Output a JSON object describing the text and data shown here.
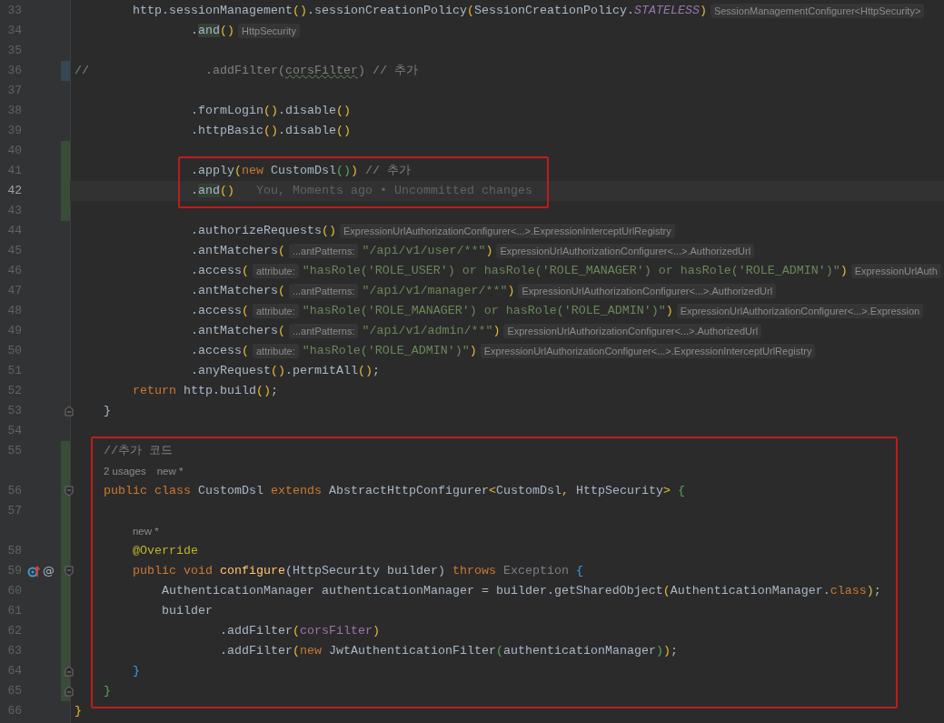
{
  "editor": {
    "blocks": [
      {
        "boxed": false,
        "rows": [
          {
            "kind": "code",
            "line": "33",
            "current": false,
            "tokens": [
              {
                "kind": "plain",
                "text": "        http.sessionManagement"
              },
              {
                "kind": "bracket1",
                "text": "()"
              },
              {
                "kind": "plain",
                "text": ".sessionCreationPolicy"
              },
              {
                "kind": "bracket1",
                "text": "("
              },
              {
                "kind": "plain",
                "text": "SessionCreationPolicy."
              },
              {
                "kind": "constant",
                "text": "STATELESS"
              },
              {
                "kind": "bracket1",
                "text": ")"
              },
              {
                "kind": "hint",
                "text": "SessionManagementConfigurer<HttpSecurity>"
              }
            ]
          },
          {
            "kind": "code",
            "line": "34",
            "current": false,
            "tokens": [
              {
                "kind": "plain",
                "text": "                ."
              },
              {
                "kind": "usage",
                "text": "and"
              },
              {
                "kind": "bracket1",
                "text": "()"
              },
              {
                "kind": "hint",
                "text": "HttpSecurity"
              }
            ]
          },
          {
            "kind": "code",
            "line": "35",
            "current": false,
            "tokens": []
          },
          {
            "kind": "code",
            "line": "36",
            "current": false,
            "modified": true,
            "tokens": [
              {
                "kind": "comment",
                "text": "//                .addFilter("
              },
              {
                "kind": "typo",
                "text": "corsFilter"
              },
              {
                "kind": "comment",
                "text": ") // 추가"
              }
            ]
          },
          {
            "kind": "code",
            "line": "37",
            "current": false,
            "tokens": []
          },
          {
            "kind": "code",
            "line": "38",
            "current": false,
            "tokens": [
              {
                "kind": "plain",
                "text": "                .formLogin"
              },
              {
                "kind": "bracket1",
                "text": "()"
              },
              {
                "kind": "plain",
                "text": ".disable"
              },
              {
                "kind": "bracket1",
                "text": "()"
              }
            ]
          },
          {
            "kind": "code",
            "line": "39",
            "current": false,
            "tokens": [
              {
                "kind": "plain",
                "text": "                .httpBasic"
              },
              {
                "kind": "bracket1",
                "text": "()"
              },
              {
                "kind": "plain",
                "text": ".disable"
              },
              {
                "kind": "bracket1",
                "text": "()"
              }
            ]
          },
          {
            "kind": "code",
            "line": "40",
            "current": false,
            "added": true,
            "tokens": []
          }
        ]
      },
      {
        "boxed": true,
        "rows": [
          {
            "kind": "code",
            "line": "41",
            "current": false,
            "added": true,
            "tokens": [
              {
                "kind": "plain",
                "text": "                .apply"
              },
              {
                "kind": "bracket1",
                "text": "("
              },
              {
                "kind": "keyword",
                "text": "new "
              },
              {
                "kind": "plain",
                "text": "CustomDsl"
              },
              {
                "kind": "bracket2",
                "text": "()"
              },
              {
                "kind": "bracket1",
                "text": ")"
              },
              {
                "kind": "comment",
                "text": " // 추가"
              }
            ]
          },
          {
            "kind": "code",
            "line": "42",
            "current": true,
            "added": true,
            "tokens": [
              {
                "kind": "plain",
                "text": "                ."
              },
              {
                "kind": "usage",
                "text": "and"
              },
              {
                "kind": "bracket1",
                "text": "()"
              },
              {
                "kind": "blame",
                "text": "You, Moments ago • Uncommitted changes"
              }
            ]
          }
        ]
      },
      {
        "boxed": false,
        "rows": [
          {
            "kind": "code",
            "line": "43",
            "current": false,
            "added": true,
            "tokens": []
          },
          {
            "kind": "code",
            "line": "44",
            "current": false,
            "tokens": [
              {
                "kind": "plain",
                "text": "                .authorizeRequests"
              },
              {
                "kind": "bracket1",
                "text": "()"
              },
              {
                "kind": "hint",
                "text": "ExpressionUrlAuthorizationConfigurer<...>.ExpressionInterceptUrlRegistry"
              }
            ]
          },
          {
            "kind": "code",
            "line": "45",
            "current": false,
            "tokens": [
              {
                "kind": "plain",
                "text": "                .antMatchers"
              },
              {
                "kind": "bracket1",
                "text": "("
              },
              {
                "kind": "hint",
                "text": "...antPatterns:"
              },
              {
                "kind": "string",
                "text": "\"/api/v1/user/**\""
              },
              {
                "kind": "bracket1",
                "text": ")"
              },
              {
                "kind": "hint",
                "text": "ExpressionUrlAuthorizationConfigurer<...>.AuthorizedUrl"
              }
            ]
          },
          {
            "kind": "code",
            "line": "46",
            "current": false,
            "tokens": [
              {
                "kind": "plain",
                "text": "                .access"
              },
              {
                "kind": "bracket1",
                "text": "("
              },
              {
                "kind": "hint",
                "text": "attribute:"
              },
              {
                "kind": "string",
                "text": "\"hasRole('ROLE_USER') or hasRole('ROLE_MANAGER') or hasRole('ROLE_ADMIN')\""
              },
              {
                "kind": "bracket1",
                "text": ")"
              },
              {
                "kind": "hint",
                "text": "ExpressionUrlAuth"
              }
            ]
          },
          {
            "kind": "code",
            "line": "47",
            "current": false,
            "tokens": [
              {
                "kind": "plain",
                "text": "                .antMatchers"
              },
              {
                "kind": "bracket1",
                "text": "("
              },
              {
                "kind": "hint",
                "text": "...antPatterns:"
              },
              {
                "kind": "string",
                "text": "\"/api/v1/manager/**\""
              },
              {
                "kind": "bracket1",
                "text": ")"
              },
              {
                "kind": "hint",
                "text": "ExpressionUrlAuthorizationConfigurer<...>.AuthorizedUrl"
              }
            ]
          },
          {
            "kind": "code",
            "line": "48",
            "current": false,
            "tokens": [
              {
                "kind": "plain",
                "text": "                .access"
              },
              {
                "kind": "bracket1",
                "text": "("
              },
              {
                "kind": "hint",
                "text": "attribute:"
              },
              {
                "kind": "string",
                "text": "\"hasRole('ROLE_MANAGER') or hasRole('ROLE_ADMIN')\""
              },
              {
                "kind": "bracket1",
                "text": ")"
              },
              {
                "kind": "hint",
                "text": "ExpressionUrlAuthorizationConfigurer<...>.Expression"
              }
            ]
          },
          {
            "kind": "code",
            "line": "49",
            "current": false,
            "tokens": [
              {
                "kind": "plain",
                "text": "                .antMatchers"
              },
              {
                "kind": "bracket1",
                "text": "("
              },
              {
                "kind": "hint",
                "text": "...antPatterns:"
              },
              {
                "kind": "string",
                "text": "\"/api/v1/admin/**\""
              },
              {
                "kind": "bracket1",
                "text": ")"
              },
              {
                "kind": "hint",
                "text": "ExpressionUrlAuthorizationConfigurer<...>.AuthorizedUrl"
              }
            ]
          },
          {
            "kind": "code",
            "line": "50",
            "current": false,
            "tokens": [
              {
                "kind": "plain",
                "text": "                .access"
              },
              {
                "kind": "bracket1",
                "text": "("
              },
              {
                "kind": "hint",
                "text": "attribute:"
              },
              {
                "kind": "string",
                "text": "\"hasRole('ROLE_ADMIN')\""
              },
              {
                "kind": "bracket1",
                "text": ")"
              },
              {
                "kind": "hint",
                "text": "ExpressionUrlAuthorizationConfigurer<...>.ExpressionInterceptUrlRegistry"
              }
            ]
          },
          {
            "kind": "code",
            "line": "51",
            "current": false,
            "tokens": [
              {
                "kind": "plain",
                "text": "                .anyRequest"
              },
              {
                "kind": "bracket1",
                "text": "()"
              },
              {
                "kind": "plain",
                "text": ".permitAll"
              },
              {
                "kind": "bracket1",
                "text": "()"
              },
              {
                "kind": "plain",
                "text": ";"
              }
            ]
          },
          {
            "kind": "code",
            "line": "52",
            "current": false,
            "tokens": [
              {
                "kind": "keyword",
                "text": "        return "
              },
              {
                "kind": "plain",
                "text": "http.build"
              },
              {
                "kind": "bracket1",
                "text": "()"
              },
              {
                "kind": "plain",
                "text": ";"
              }
            ]
          },
          {
            "kind": "code",
            "line": "53",
            "current": false,
            "fold_end": true,
            "tokens": [
              {
                "kind": "plain",
                "text": "    }"
              }
            ]
          },
          {
            "kind": "code",
            "line": "54",
            "current": false,
            "tokens": []
          }
        ]
      },
      {
        "boxed": true,
        "rows": [
          {
            "kind": "code",
            "line": "55",
            "current": false,
            "added": true,
            "tokens": [
              {
                "kind": "comment",
                "text": "    //추가 코드"
              }
            ]
          },
          {
            "kind": "vision",
            "added": true,
            "tokens": [
              {
                "kind": "vision",
                "text": "2 usages"
              },
              {
                "kind": "vision",
                "text": "new *"
              }
            ]
          },
          {
            "kind": "code",
            "line": "56",
            "current": false,
            "added": true,
            "fold_start": true,
            "tokens": [
              {
                "kind": "keyword",
                "text": "    public class "
              },
              {
                "kind": "plain",
                "text": "CustomDsl "
              },
              {
                "kind": "keyword",
                "text": "extends "
              },
              {
                "kind": "plain",
                "text": "AbstractHttpConfigurer"
              },
              {
                "kind": "bracket1",
                "text": "<"
              },
              {
                "kind": "plain",
                "text": "CustomDsl"
              },
              {
                "kind": "bracket1",
                "text": ","
              },
              {
                "kind": "plain",
                "text": " HttpSecurity"
              },
              {
                "kind": "bracket1",
                "text": ">"
              },
              {
                "kind": "bracket2",
                "text": " {"
              }
            ]
          },
          {
            "kind": "code",
            "line": "57",
            "current": false,
            "added": true,
            "tokens": []
          },
          {
            "kind": "vision",
            "added": true,
            "tokens": [
              {
                "kind": "vision",
                "text": "new *"
              }
            ]
          },
          {
            "kind": "code",
            "line": "58",
            "current": false,
            "added": true,
            "tokens": [
              {
                "kind": "annotation",
                "text": "        @Override"
              }
            ]
          },
          {
            "kind": "code",
            "line": "59",
            "current": false,
            "added": true,
            "fold_start": true,
            "override": true,
            "gutter_glyph": "@",
            "tokens": [
              {
                "kind": "keyword",
                "text": "        public void "
              },
              {
                "kind": "method",
                "text": "configure"
              },
              {
                "kind": "plain",
                "text": "(HttpSecurity builder)"
              },
              {
                "kind": "keyword",
                "text": " throws "
              },
              {
                "kind": "dim",
                "text": "Exception "
              },
              {
                "kind": "bracket3",
                "text": "{"
              }
            ]
          },
          {
            "kind": "code",
            "line": "60",
            "current": false,
            "added": true,
            "tokens": [
              {
                "kind": "plain",
                "text": "            AuthenticationManager authenticationManager = builder.getSharedObject"
              },
              {
                "kind": "bracket1",
                "text": "("
              },
              {
                "kind": "plain",
                "text": "AuthenticationManager."
              },
              {
                "kind": "keyword",
                "text": "class"
              },
              {
                "kind": "bracket1",
                "text": ")"
              },
              {
                "kind": "plain",
                "text": ";"
              }
            ]
          },
          {
            "kind": "code",
            "line": "61",
            "current": false,
            "added": true,
            "tokens": [
              {
                "kind": "plain",
                "text": "            builder"
              }
            ]
          },
          {
            "kind": "code",
            "line": "62",
            "current": false,
            "added": true,
            "tokens": [
              {
                "kind": "plain",
                "text": "                    .addFilter"
              },
              {
                "kind": "bracket1",
                "text": "("
              },
              {
                "kind": "member",
                "text": "corsFilter"
              },
              {
                "kind": "bracket1",
                "text": ")"
              }
            ]
          },
          {
            "kind": "code",
            "line": "63",
            "current": false,
            "added": true,
            "tokens": [
              {
                "kind": "plain",
                "text": "                    .addFilter"
              },
              {
                "kind": "bracket1",
                "text": "("
              },
              {
                "kind": "keyword",
                "text": "new "
              },
              {
                "kind": "plain",
                "text": "JwtAuthenticationFilter"
              },
              {
                "kind": "bracket2",
                "text": "("
              },
              {
                "kind": "plain",
                "text": "authenticationManager"
              },
              {
                "kind": "bracket2",
                "text": ")"
              },
              {
                "kind": "bracket1",
                "text": ")"
              },
              {
                "kind": "plain",
                "text": ";"
              }
            ]
          },
          {
            "kind": "code",
            "line": "64",
            "current": false,
            "added": true,
            "fold_end": true,
            "tokens": [
              {
                "kind": "bracket3",
                "text": "        }"
              }
            ]
          },
          {
            "kind": "code",
            "line": "65",
            "current": false,
            "added": true,
            "fold_end": true,
            "tokens": [
              {
                "kind": "bracket2",
                "text": "    }"
              }
            ]
          }
        ]
      },
      {
        "boxed": false,
        "rows": [
          {
            "kind": "code",
            "line": "66",
            "current": false,
            "tokens": [
              {
                "kind": "bracket1",
                "text": "}"
              }
            ]
          }
        ]
      }
    ]
  }
}
